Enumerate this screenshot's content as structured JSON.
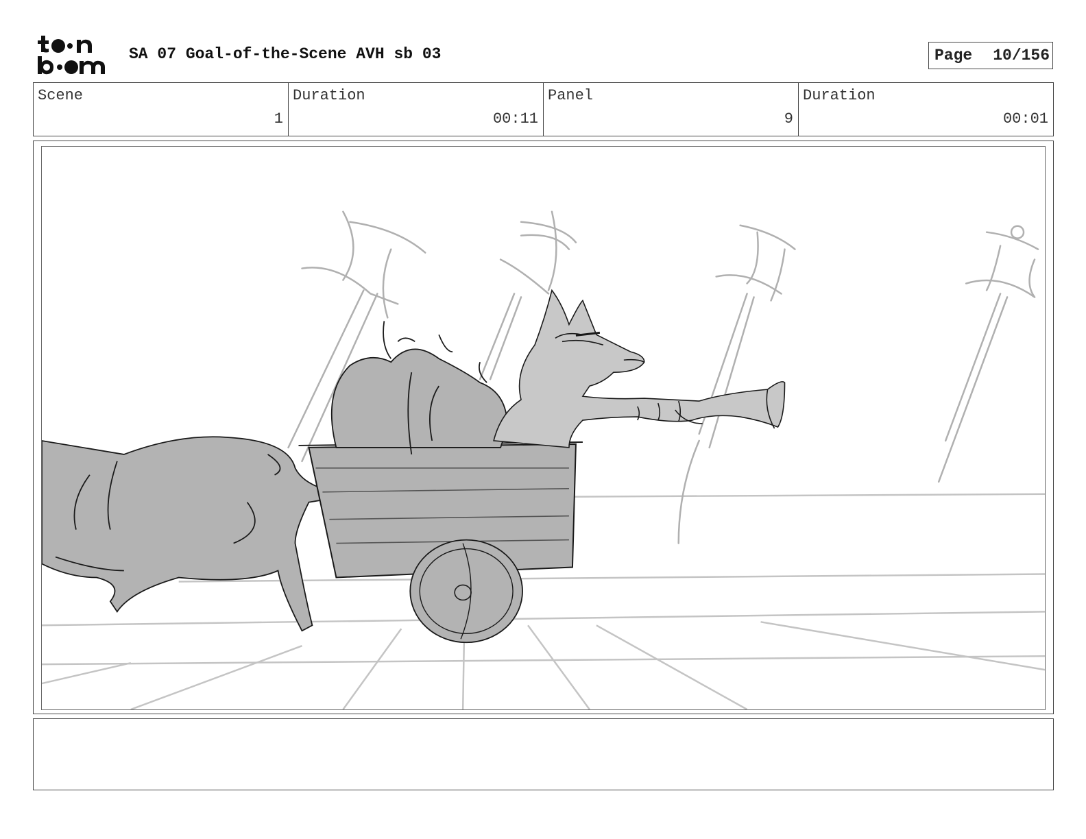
{
  "header": {
    "logo": {
      "name": "toon-boom-logo",
      "text": "toon boom"
    },
    "title": "SA 07 Goal-of-the-Scene AVH sb 03",
    "page_label": "Page",
    "page_value": "10/156"
  },
  "info": {
    "scene_label": "Scene",
    "scene_value": "1",
    "scene_duration_label": "Duration",
    "scene_duration_value": "00:11",
    "panel_label": "Panel",
    "panel_value": "9",
    "panel_duration_label": "Duration",
    "panel_duration_value": "00:01"
  },
  "panel": {
    "image": "storyboard-sketch-fox-in-cart-pulled-by-animal",
    "colors": {
      "shadow": "#b3b3b3",
      "line": "#1a1a1a",
      "light": "#c8c8c8"
    }
  },
  "notes": {
    "text": ""
  }
}
